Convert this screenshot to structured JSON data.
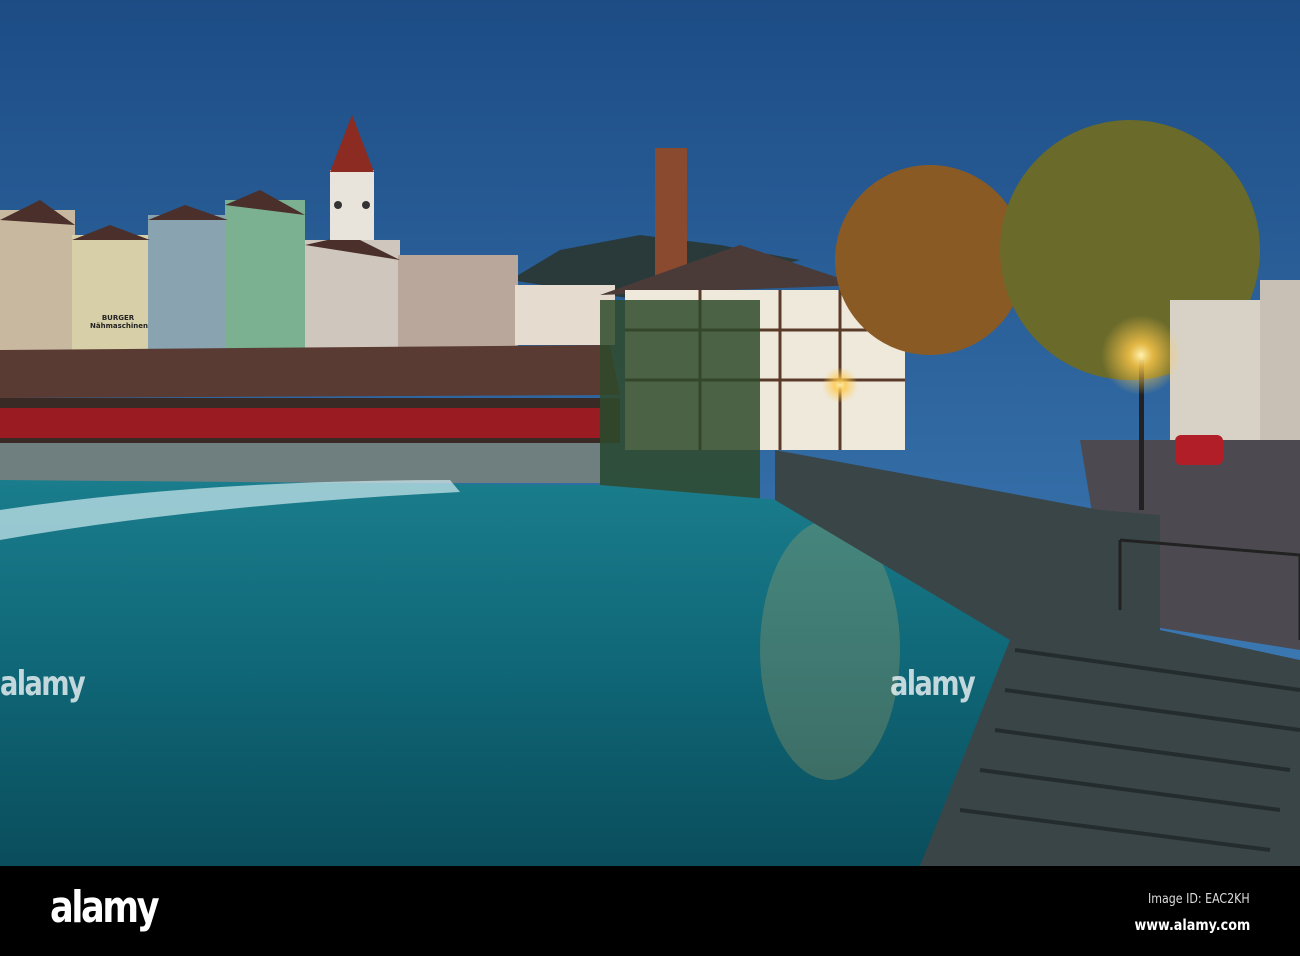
{
  "photo": {
    "subject": "Thun old town river scene at dusk",
    "shop_sign": {
      "line1": "BURGER",
      "line2": "Nähmaschinen"
    },
    "colors": {
      "sky_top": "#1f4f86",
      "sky_bottom": "#3f7fb8",
      "water": "#0f6a7a",
      "lamp": "#ffc94a"
    }
  },
  "watermarks": {
    "center_left": "alamy",
    "center_right": "alamy"
  },
  "footer": {
    "logo": "alamy",
    "image_id": "Image ID: EAC2KH",
    "url": "www.alamy.com"
  }
}
